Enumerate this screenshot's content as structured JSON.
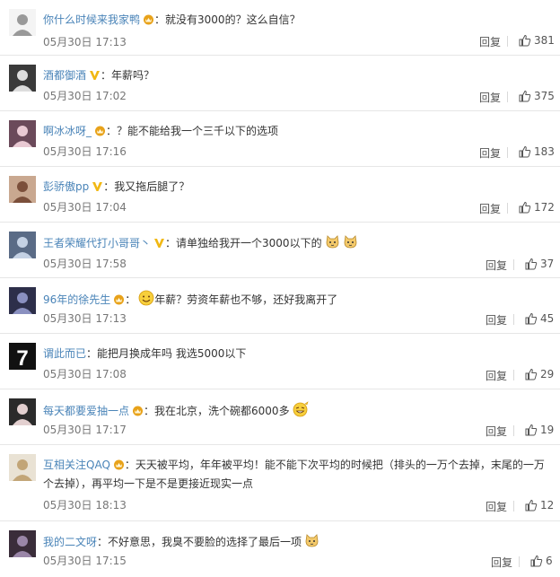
{
  "comments": [
    {
      "user": "你什么时候来我家鸭",
      "badge": "crown-badge",
      "text": "就没有3000的？这么自信？",
      "time": "05月30日 17:13",
      "reply": "回复",
      "likes": "381",
      "emojis": []
    },
    {
      "user": "酒都御酒",
      "badge": "v-badge",
      "text": "年薪吗？",
      "time": "05月30日 17:02",
      "reply": "回复",
      "likes": "375",
      "emojis": []
    },
    {
      "user": "啊冰冰呀_",
      "badge": "crown-badge",
      "text": "？能不能给我一个三千以下的选项",
      "time": "05月30日 17:16",
      "reply": "回复",
      "likes": "183",
      "emojis": []
    },
    {
      "user": "彭骄傲pp",
      "badge": "v-badge",
      "text": "我又拖后腿了？",
      "time": "05月30日 17:04",
      "reply": "回复",
      "likes": "172",
      "emojis": []
    },
    {
      "user": "王者荣耀代打小哥哥丶",
      "badge": "v-badge",
      "text": "请单独给我开一个3000以下的",
      "time": "05月30日 17:58",
      "reply": "回复",
      "likes": "37",
      "emojis": [
        "dog-face-emoji",
        "dog-face-emoji"
      ]
    },
    {
      "user": "96年的徐先生",
      "badge": "crown-badge",
      "text": "年薪？劳资年薪也不够，还好我离开了",
      "time": "05月30日 17:13",
      "reply": "回复",
      "likes": "45",
      "emojis": [
        "smile-emoji"
      ]
    },
    {
      "user": "谓此而已",
      "badge": "",
      "text": "能把月换成年吗 我选5000以下",
      "time": "05月30日 17:08",
      "reply": "回复",
      "likes": "29",
      "emojis": []
    },
    {
      "user": "每天都要爱抽一点",
      "badge": "crown-badge",
      "text": "我在北京，洗个碗都6000多",
      "time": "05月30日 17:17",
      "reply": "回复",
      "likes": "19",
      "emojis": [
        "grin-wave-emoji"
      ]
    },
    {
      "user": "互相关注QAQ",
      "badge": "crown-badge",
      "text": "天天被平均，年年被平均！能不能下次平均的时候把（排头的一万个去掉，末尾的一万个去掉），再平均一下是不是更接近现实一点",
      "time": "05月30日 18:13",
      "reply": "回复",
      "likes": "12",
      "emojis": []
    },
    {
      "user": "我的二文呀",
      "badge": "",
      "text": "不好意思，我臭不要脸的选择了最后一项",
      "time": "05月30日 17:15",
      "reply": "回复",
      "likes": "6",
      "emojis": [
        "dog-face-emoji"
      ]
    }
  ],
  "colors": {
    "username": "#4a84b8",
    "separator": "#e6e6e6",
    "crown": "#e8a21a",
    "vbadge": "#f1b814"
  }
}
